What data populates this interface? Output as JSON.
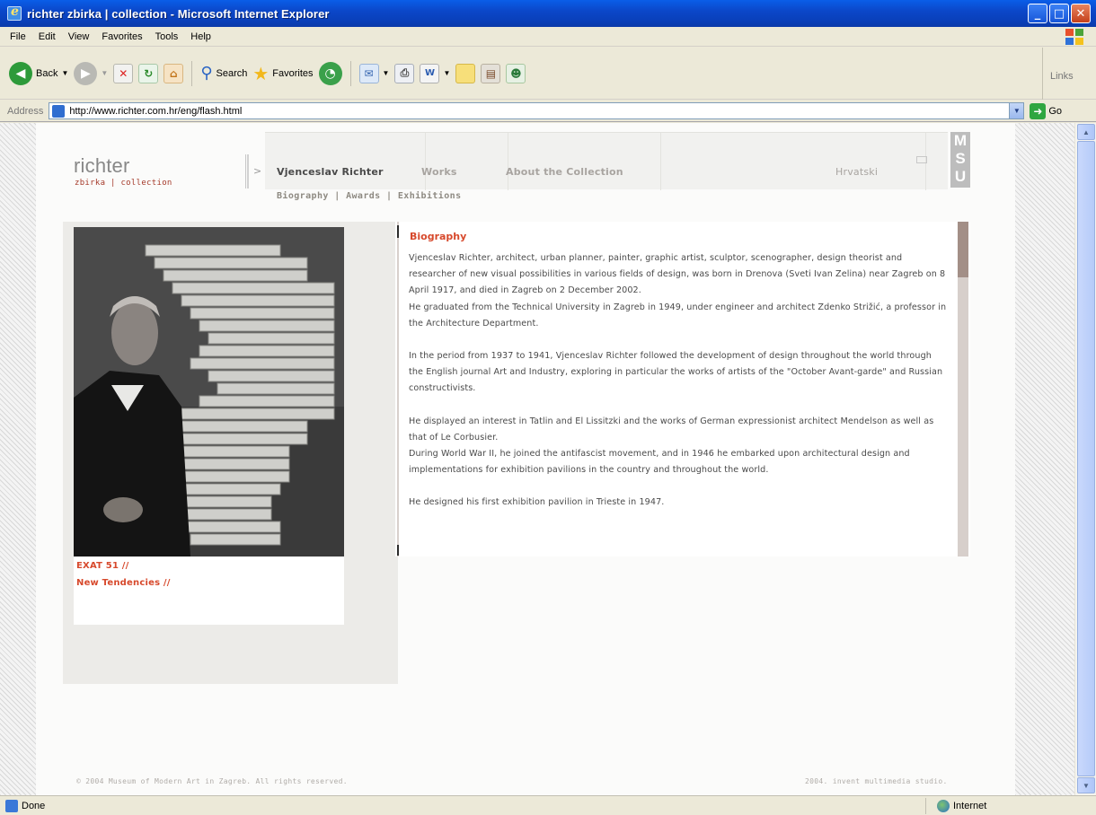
{
  "window": {
    "title": "richter zbirka | collection - Microsoft Internet Explorer",
    "controls": [
      "_",
      "□",
      "✕"
    ]
  },
  "menubar": [
    "File",
    "Edit",
    "View",
    "Favorites",
    "Tools",
    "Help"
  ],
  "toolbar": {
    "back_label": "Back",
    "search_label": "Search",
    "favorites_label": "Favorites",
    "links_label": "Links"
  },
  "address": {
    "label": "Address",
    "url": "http://www.richter.com.hr/eng/flash.html",
    "go_label": "Go"
  },
  "site": {
    "logo_main": "richter",
    "logo_sub": "zbirka | collection",
    "nav": {
      "richter": "Vjenceslav Richter",
      "works": "Works",
      "about": "About the Collection",
      "lang": "Hrvatski"
    },
    "subnav": [
      "Biography",
      "Awards",
      "Exhibitions"
    ],
    "subnav_sep": "|",
    "msu_letters": [
      "M",
      "S",
      "U"
    ],
    "exhibitions": [
      "EXAT 51 //",
      "New Tendencies //"
    ],
    "biography": {
      "heading": "Biography",
      "paragraphs": [
        "Vjenceslav Richter, architect, urban planner, painter, graphic artist, sculptor, scenographer, design theorist and researcher of new visual possibilities in various fields of design, was born in Drenova (Sveti Ivan Zelina) near Zagreb on 8 April 1917, and died in Zagreb on 2 December 2002.",
        "He graduated from the Technical University in Zagreb in 1949, under engineer and architect Zdenko Strižić, a professor in the Architecture Department.",
        "In the period from 1937 to 1941, Vjenceslav Richter followed the development of design throughout the world through the English journal Art and Industry, exploring in particular the works of artists of the \"October Avant-garde\" and Russian constructivists.",
        "He displayed an interest in Tatlin and El Lissitzki and the works of German expressionist architect Mendelson as well as that of Le Corbusier.",
        "During World War II, he joined the antifascist movement, and in 1946 he embarked upon architectural design and implementations for exhibition pavilions in the country and throughout the world.",
        "He designed his first exhibition pavilion in Trieste in 1947."
      ]
    },
    "footer_left": "© 2004 Museum of Modern Art in Zagreb. All rights reserved.",
    "footer_right": "2004. invent multimedia studio."
  },
  "status": {
    "text": "Done",
    "zone": "Internet"
  },
  "colors": {
    "accent": "#d7492c",
    "titlebar": "#0b47c9"
  }
}
